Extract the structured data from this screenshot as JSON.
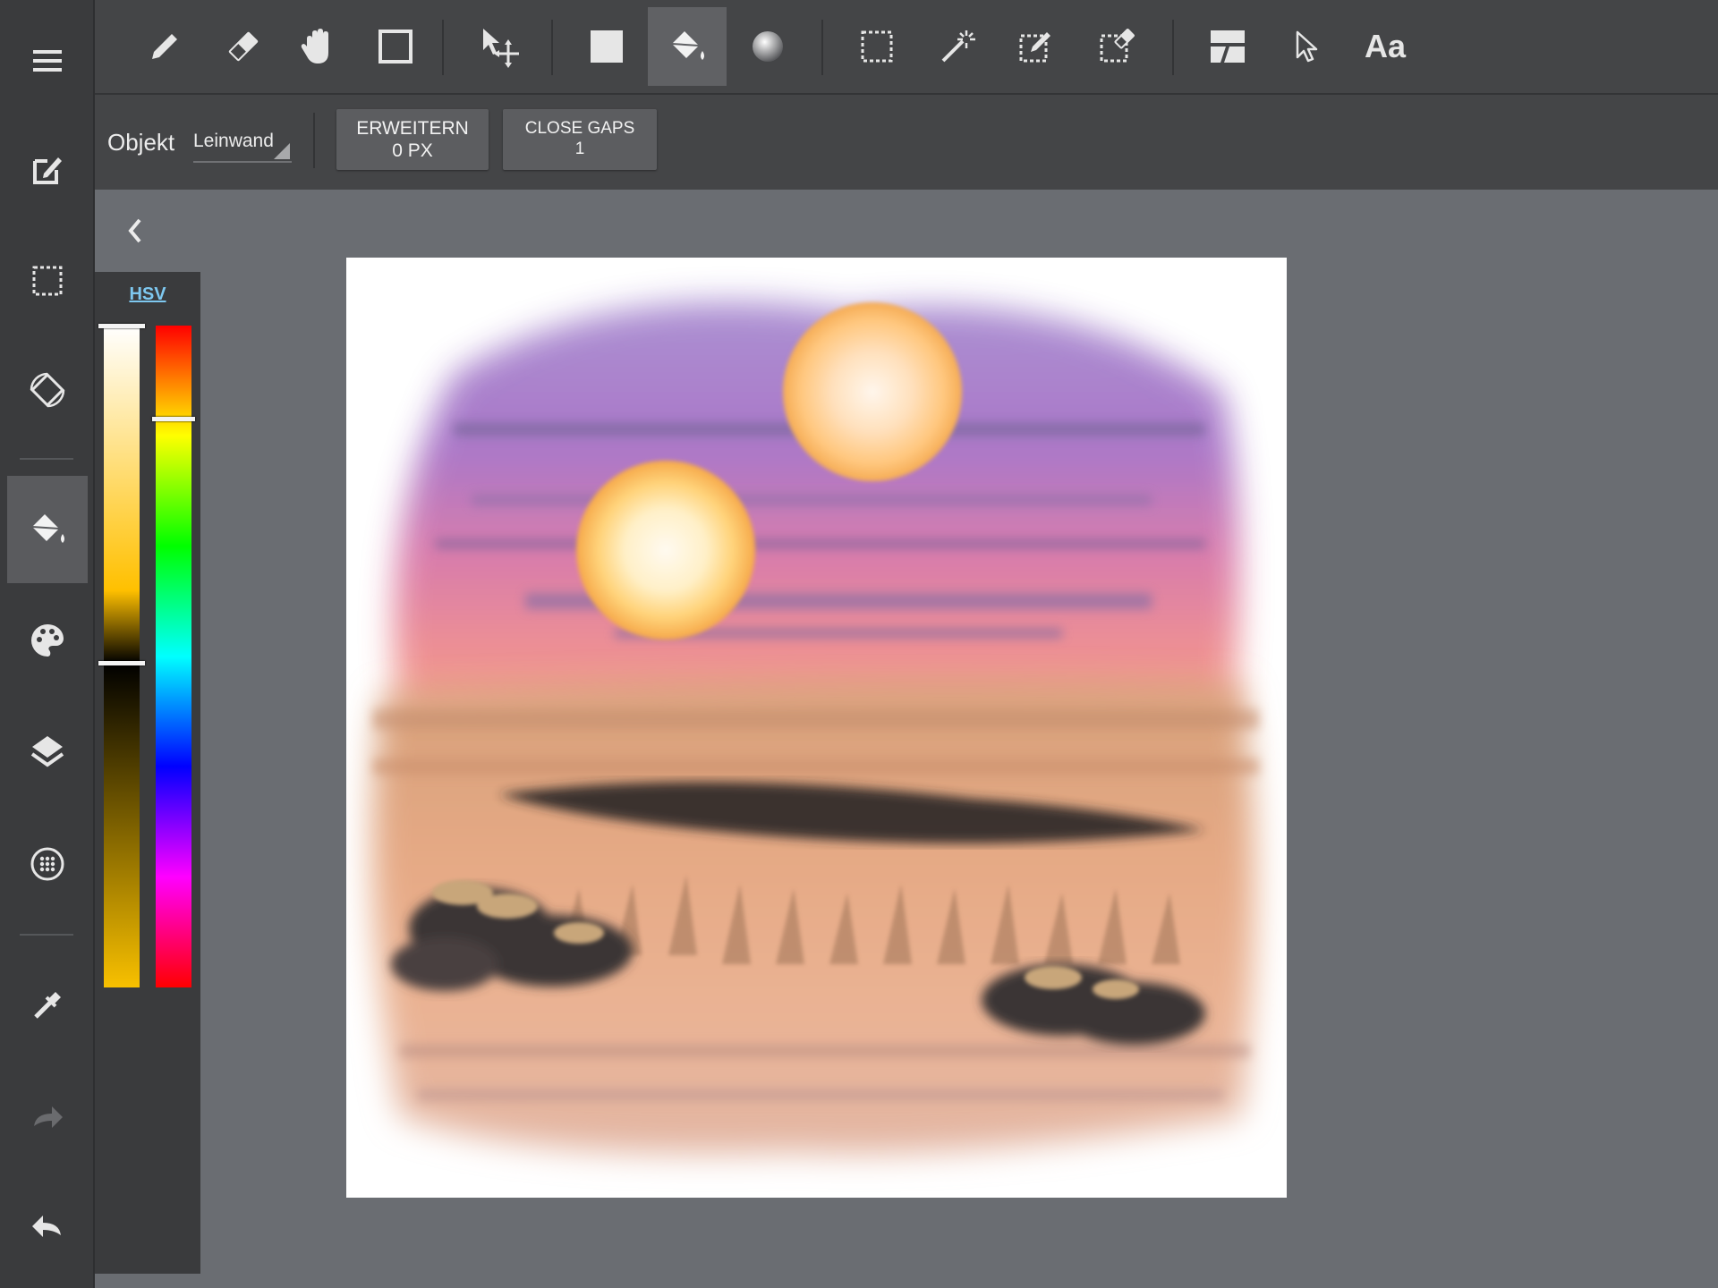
{
  "toolbar": {
    "tools": [
      {
        "icon": "pencil-icon",
        "state": "normal"
      },
      {
        "icon": "eraser-icon",
        "state": "normal"
      },
      {
        "icon": "hand-icon",
        "state": "normal"
      },
      {
        "icon": "shape-rectangle-icon",
        "state": "normal"
      },
      {
        "icon": "move-selection-icon",
        "state": "normal"
      },
      {
        "icon": "fill-color-icon",
        "state": "normal"
      },
      {
        "icon": "paint-bucket-icon",
        "state": "active"
      },
      {
        "icon": "gradient-icon",
        "state": "normal"
      },
      {
        "icon": "rect-select-icon",
        "state": "normal"
      },
      {
        "icon": "magic-wand-icon",
        "state": "normal"
      },
      {
        "icon": "select-pen-icon",
        "state": "normal"
      },
      {
        "icon": "select-eraser-icon",
        "state": "normal"
      },
      {
        "icon": "panel-layout-icon",
        "state": "normal"
      },
      {
        "icon": "pointer-icon",
        "state": "normal"
      }
    ],
    "text_tool_label": "Aa"
  },
  "options": {
    "object_label": "Objekt",
    "object_value": "Leinwand",
    "expand_label": "ERWEITERN",
    "expand_value": "0 PX",
    "close_gaps_label": "CLOSE GAPS",
    "close_gaps_value": "1"
  },
  "sidebar": {
    "items": [
      {
        "icon": "menu-icon"
      },
      {
        "icon": "edit-canvas-icon"
      },
      {
        "icon": "selection-icon"
      },
      {
        "icon": "rotate-screen-icon"
      },
      {
        "icon": "paint-bucket-icon",
        "active": true
      },
      {
        "icon": "palette-icon"
      },
      {
        "icon": "layers-icon"
      },
      {
        "icon": "dot-grid-icon"
      },
      {
        "icon": "eyedropper-icon"
      },
      {
        "icon": "redo-icon",
        "disabled": true
      },
      {
        "icon": "undo-icon"
      }
    ]
  },
  "color_panel": {
    "mode_label": "HSV",
    "value_level": 0.51,
    "hue_level": 0.14
  },
  "canvas": {
    "artwork": "desert-sunset-two-suns"
  },
  "colors": {
    "rail_bg": "#3a3b3d",
    "toolbar_bg": "#444547",
    "workspace_bg": "#6a6d72",
    "active_tool_bg": "#606164",
    "link": "#7ec8f0"
  }
}
